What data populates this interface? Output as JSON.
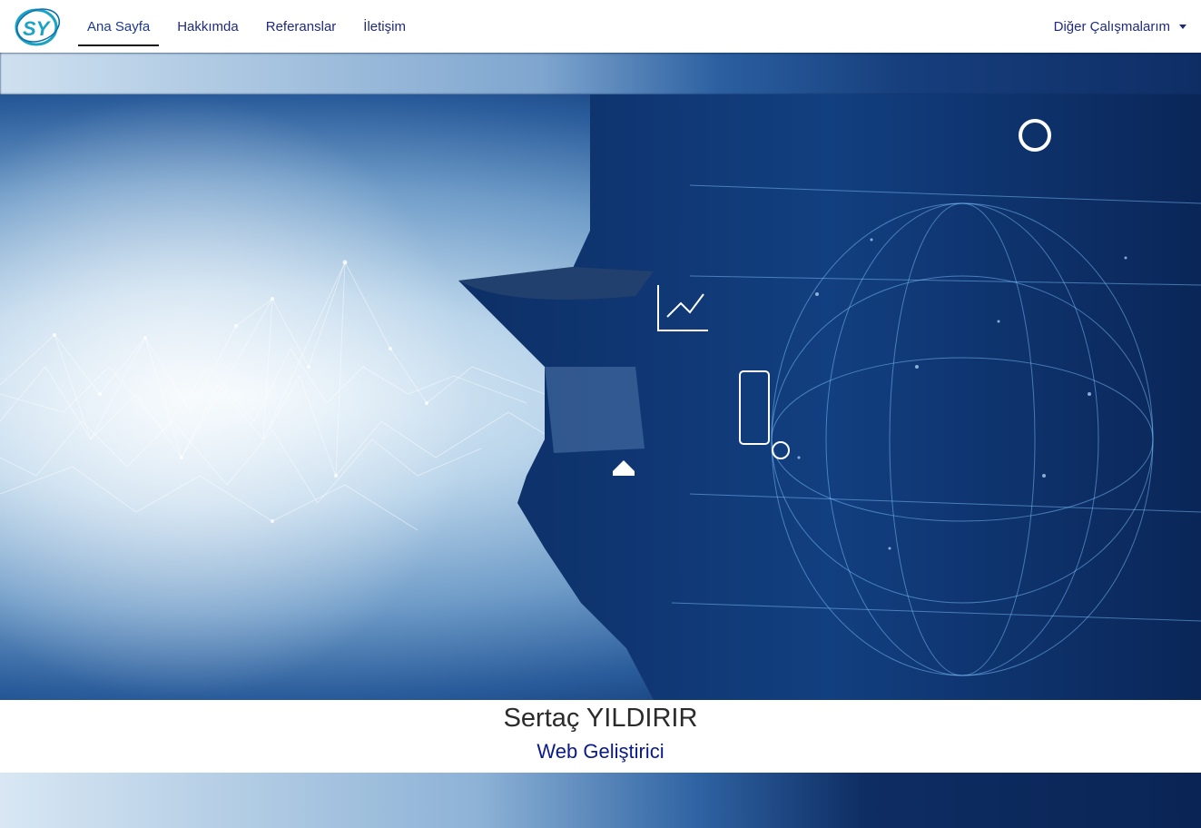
{
  "nav": {
    "logo_text": "SY",
    "links": [
      {
        "label": "Ana Sayfa",
        "active": true
      },
      {
        "label": "Hakkımda",
        "active": false
      },
      {
        "label": "Referanslar",
        "active": false
      },
      {
        "label": "İletişim",
        "active": false
      }
    ],
    "dropdown_label": "Diğer Çalışmalarım"
  },
  "hero": {
    "image": "engineer-with-hard-hat-digital-network-icon"
  },
  "caption": {
    "name": "Sertaç YILDIRIR",
    "role": "Web Geliştirici"
  },
  "colors": {
    "nav_bg": "#ffffff",
    "nav_link": "#1f2b7a",
    "name_text": "#2b2b2b",
    "role_text": "#0a1a8c",
    "logo_teal": "#1ba3c6"
  }
}
